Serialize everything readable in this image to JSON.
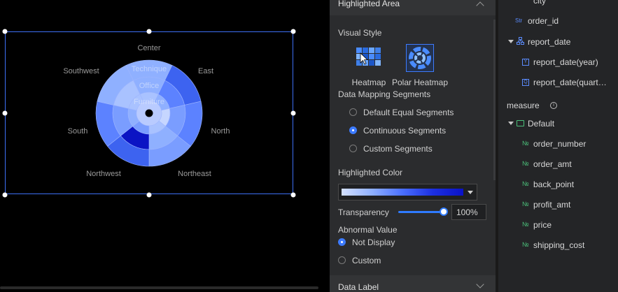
{
  "chart_data": {
    "type": "polar_heatmap",
    "directions": [
      "Center",
      "East",
      "North",
      "Northeast",
      "Northwest",
      "South",
      "Southwest"
    ],
    "rings": [
      "Technique",
      "Office",
      "Furniture"
    ],
    "center_label": "",
    "colors": {
      "low": "#c3d4ff",
      "mid": "#7fa2ff",
      "high": "#0a14c8"
    }
  },
  "panel": {
    "header_title": "Highlighted Area",
    "visual_style_label": "Visual Style",
    "styles": [
      {
        "label": "Heatmap",
        "icon": "heatmap-icon",
        "selected": false
      },
      {
        "label": "Polar Heatmap",
        "icon": "polar-heatmap-icon",
        "selected": true
      }
    ],
    "mapping_label": "Data Mapping Segments",
    "mapping_options": [
      {
        "label": "Default Equal Segments",
        "checked": false
      },
      {
        "label": "Continuous Segments",
        "checked": true
      },
      {
        "label": "Custom Segments",
        "checked": false
      }
    ],
    "highlight_color_label": "Highlighted Color",
    "transparency_label": "Transparency",
    "transparency_value": "100%",
    "transparency_fraction": 1.0,
    "abnormal_label": "Abnormal Value",
    "abnormal_options": [
      {
        "label": "Not Display",
        "checked": true
      },
      {
        "label": "Custom",
        "checked": false
      }
    ],
    "data_label": "Data Label"
  },
  "fields": {
    "partial_top": "city",
    "order_id": "order_id",
    "report_date": "report_date",
    "report_date_year": "report_date(year)",
    "report_date_quarter": "report_date(quart…",
    "measure_label": "measure",
    "default_folder": "Default",
    "measures": [
      "order_number",
      "order_amt",
      "back_point",
      "profit_amt",
      "price",
      "shipping_cost"
    ],
    "type_str": "Str",
    "type_num": "№",
    "year_badge": "Y",
    "quarter_badge": "Q"
  }
}
